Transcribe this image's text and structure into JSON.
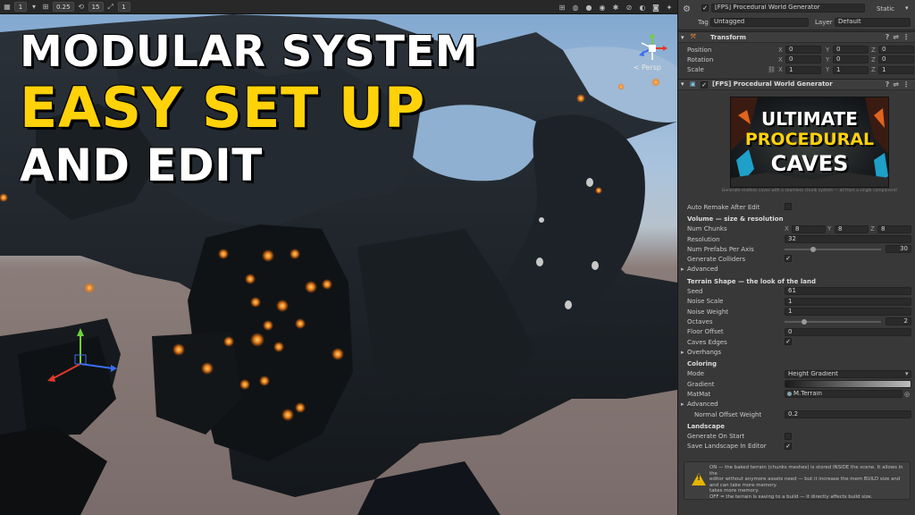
{
  "toolbar": {
    "left_value": "1",
    "grid_value": "0.25",
    "snap_value": "15",
    "scale_value": "1"
  },
  "thumbnail_text": {
    "line1": "MODULAR SYSTEM",
    "line2": "EASY SET UP",
    "line3": "AND EDIT",
    "line1_color": "#ffffff",
    "line2_color": "#ffd20a",
    "line3_color": "#ffffff"
  },
  "scene": {
    "projection_label": "< Persp"
  },
  "inspector": {
    "object_name": "[FPS] Procedural World Generator",
    "static_label": "Static",
    "tag_label": "Tag",
    "tag_value": "Untagged",
    "layer_label": "Layer",
    "layer_value": "Default",
    "transform": {
      "title": "Transform",
      "position_label": "Position",
      "rotation_label": "Rotation",
      "scale_label": "Scale",
      "position": [
        "0",
        "0",
        "0"
      ],
      "rotation": [
        "0",
        "0",
        "0"
      ],
      "scale": [
        "1",
        "1",
        "1"
      ],
      "axis_x": "X",
      "axis_y": "Y",
      "axis_z": "Z"
    },
    "component_title": "[FPS] Procedural World Generator",
    "banner": {
      "line1": "ULTIMATE",
      "line2": "PROCEDURAL",
      "line3": "CAVES",
      "caption": "Generate endless caves with a seamless chunk system — all from a single component!"
    },
    "fields": {
      "auto_remake": "Auto Remake After Edit",
      "volume_header": "Volume — size & resolution",
      "num_chunks": "Num Chunks",
      "num_chunks_values": [
        "8",
        "8",
        "8"
      ],
      "resolution": "Resolution",
      "resolution_value": "32",
      "num_prefabs": "Num Prefabs Per Axis",
      "num_prefabs_value": "30",
      "generate_colliders": "Generate Colliders",
      "advanced1": "Advanced",
      "terrain_header": "Terrain Shape — the look of the land",
      "seed": "Seed",
      "seed_value": "61",
      "noise_scale": "Noise Scale",
      "noise_scale_value": "1",
      "noise_weight": "Noise Weight",
      "noise_weight_value": "1",
      "octaves": "Octaves",
      "octaves_value": "2",
      "floor_offset": "Floor Offset",
      "floor_offset_value": "0",
      "caves_edges": "Caves Edges",
      "overhangs": "Overhangs",
      "coloring_header": "Coloring",
      "mode": "Mode",
      "mode_value": "Height Gradient",
      "gradient": "Gradient",
      "mat": "MatMat",
      "mat_value": "M.Terrain",
      "advanced2": "Advanced",
      "normal_offset": "Normal Offset Weight",
      "normal_offset_value": "0.2",
      "landscape_header": "Landscape",
      "generate_on_start": "Generate On Start",
      "save_landscape": "Save Landscape In Editor"
    },
    "help_text": {
      "line1": "ON — the baked terrain (chunks meshes) is stored INSIDE the scene. It allows in the",
      "line2": "editor without anymore assets need — but it increase the mem BUILD size and",
      "line3": "and can take more memory.",
      "line4": "takes more memory.",
      "line5": "OFF = the terrain is saving to a build — it directly affects build size."
    }
  }
}
